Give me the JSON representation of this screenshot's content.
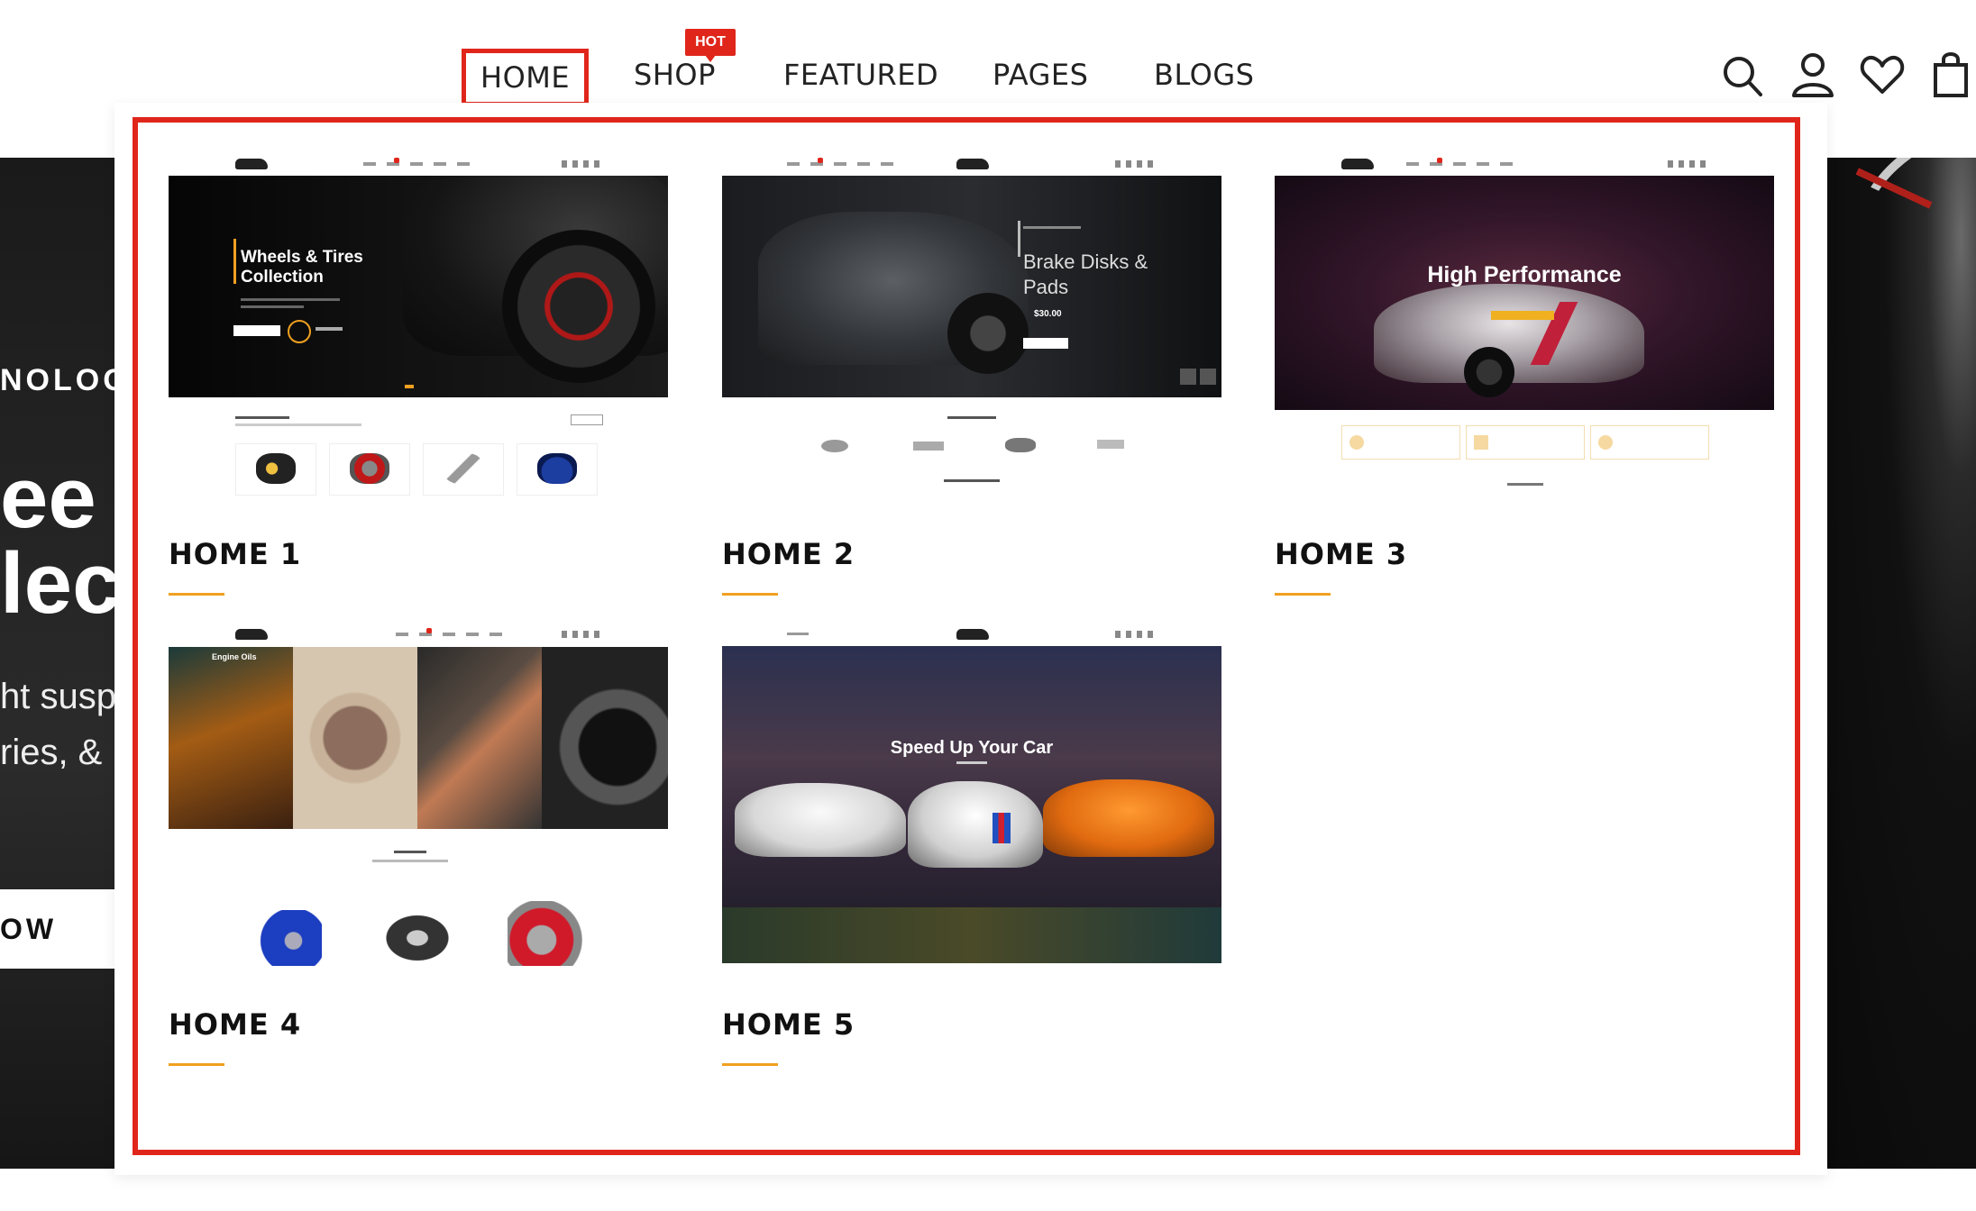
{
  "nav": {
    "items": [
      {
        "label": "HOME",
        "active": true
      },
      {
        "label": "SHOP",
        "badge": "HOT"
      },
      {
        "label": "FEATURED"
      },
      {
        "label": "PAGES"
      },
      {
        "label": "BLOGS"
      }
    ],
    "icons": [
      "search-icon",
      "user-icon",
      "heart-icon",
      "shopping-bag-icon"
    ]
  },
  "hero_background": {
    "tag": "NOLOG",
    "title_line1": "ee",
    "title_line2": "lec",
    "sub_line1": "ht susp",
    "sub_line2": "ries, &",
    "button": "OW"
  },
  "mega_menu": {
    "demos": [
      {
        "label": "HOME 1",
        "banner_title": "Wheels & Tires Collection"
      },
      {
        "label": "HOME 2",
        "banner_title": "Brake Disks & Pads",
        "banner_price": "$30.00"
      },
      {
        "label": "HOME 3",
        "banner_title": "High Performance"
      },
      {
        "label": "HOME 4",
        "banner_title": "Engine Oils"
      },
      {
        "label": "HOME 5",
        "banner_title": "Speed Up Your Car"
      }
    ]
  },
  "colors": {
    "accent_red": "#e0261b",
    "underline_orange": "#f0a020",
    "text_dark": "#111111"
  }
}
